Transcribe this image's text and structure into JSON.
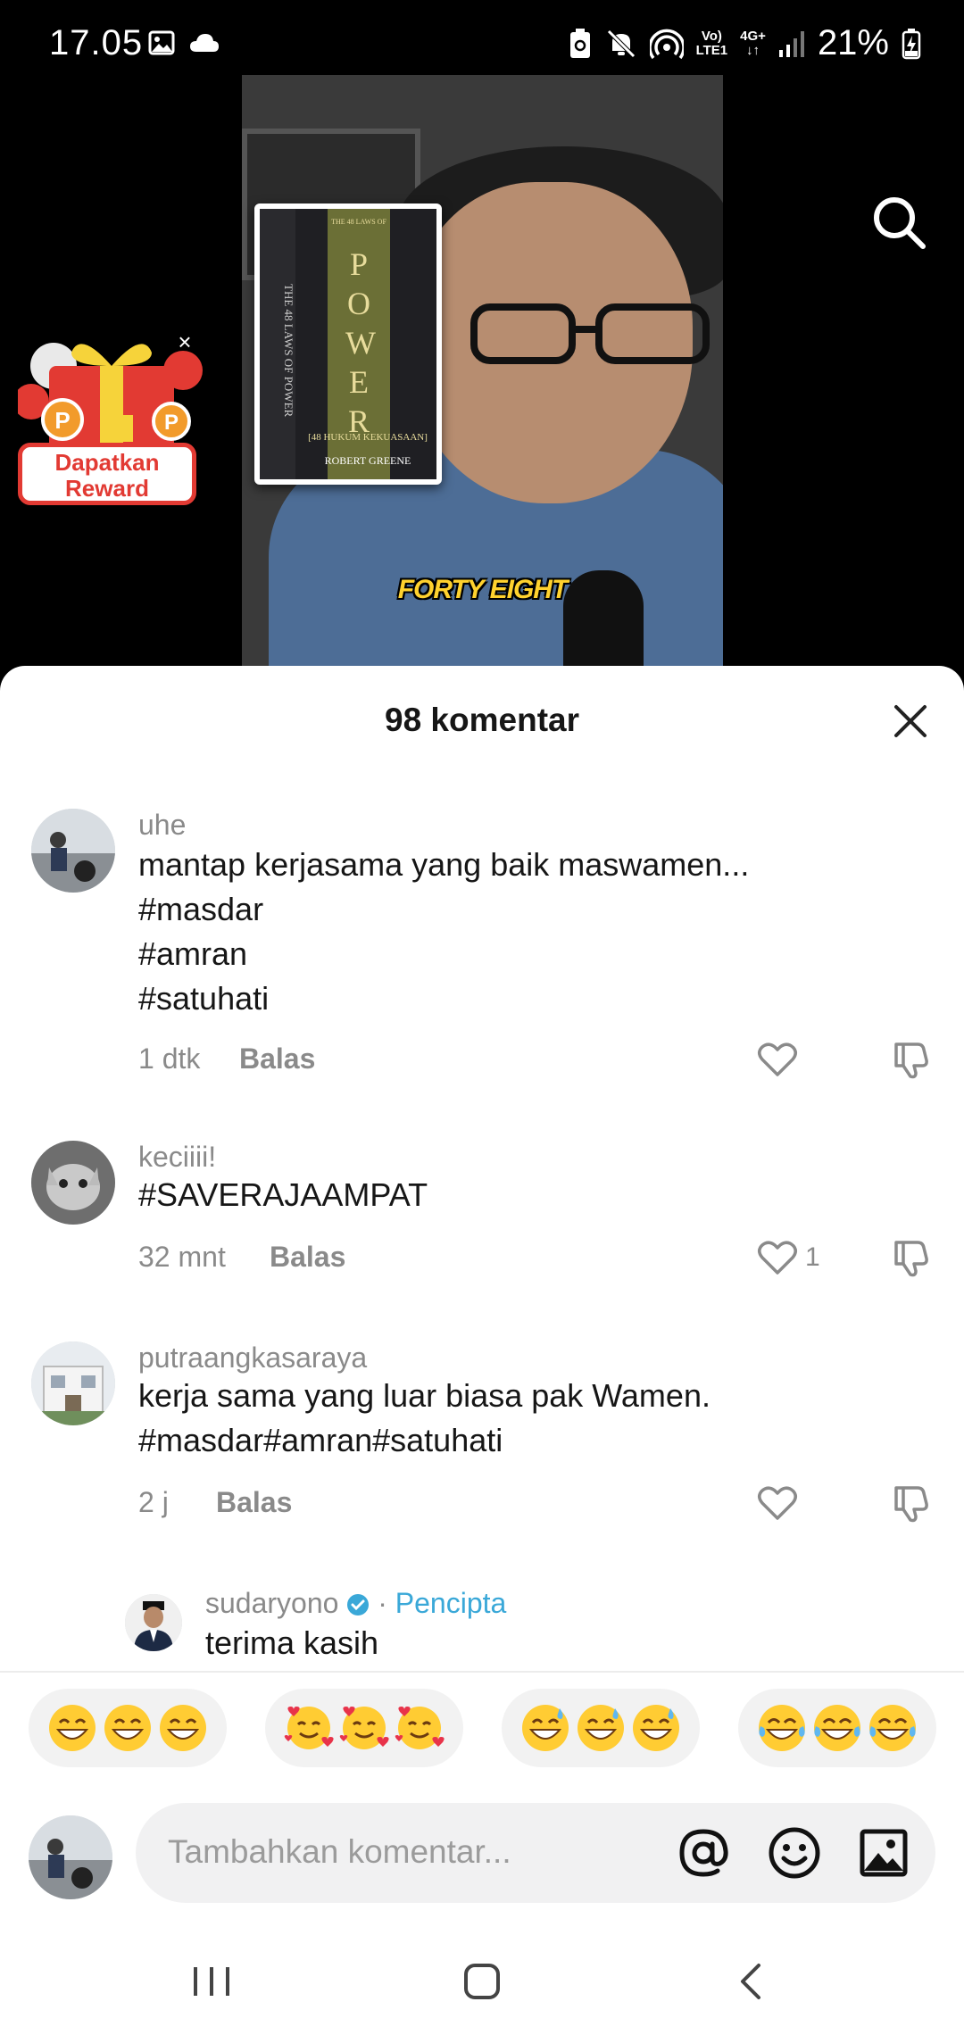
{
  "status_bar": {
    "time": "17.05",
    "net_top": "Vo)",
    "net_bottom": "LTE1",
    "net_type": "4G+",
    "battery": "21%"
  },
  "video": {
    "caption": "FORTY EIGHT",
    "book": {
      "title": "POWER",
      "top_text": "THE 48 LAWS OF",
      "subtitle": "[48 HUKUM KEKUASAAN]",
      "author": "ROBERT GREENE",
      "spine": "THE 48 LAWS OF POWER"
    }
  },
  "reward": {
    "label_line1": "Dapatkan",
    "label_line2": "Reward",
    "close": "×"
  },
  "sheet": {
    "title": "98 komentar"
  },
  "comments": [
    {
      "username": "uhe",
      "text": "mantap kerjasama yang baik maswamen...\n#masdar\n#amran\n#satuhati",
      "time": "1 dtk",
      "reply": "Balas",
      "likes": ""
    },
    {
      "username": "keciiii!",
      "text": "#SAVERAJAAMPAT",
      "time": "32 mnt",
      "reply": "Balas",
      "likes": "1"
    },
    {
      "username": "putraangkasaraya",
      "text": "kerja sama yang luar biasa pak Wamen.\n#masdar#amran#satuhati",
      "time": "2 j",
      "reply": "Balas",
      "likes": ""
    }
  ],
  "reply_comment": {
    "username": "sudaryono",
    "separator": "·",
    "creator_tag": "Pencipta",
    "text": "terima kasih"
  },
  "input": {
    "placeholder": "Tambahkan komentar..."
  },
  "colors": {
    "accent_blue": "#3aa8d8",
    "reward_red": "#e23a33",
    "caption_yellow": "#ffd22e"
  }
}
